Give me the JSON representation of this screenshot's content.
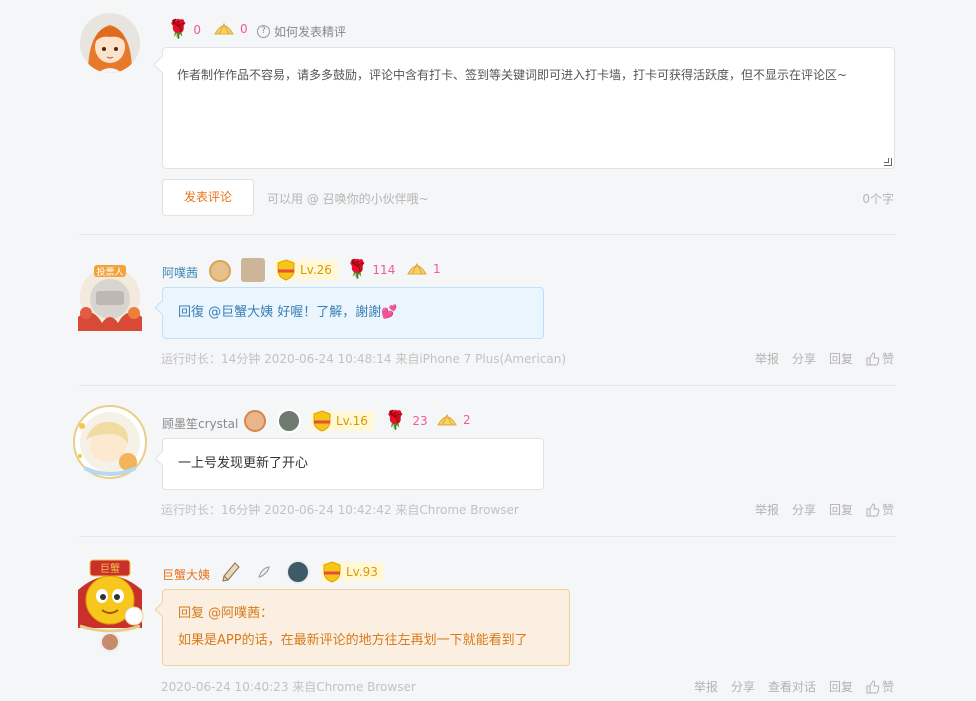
{
  "compose": {
    "flower_count": "0",
    "shell_count": "0",
    "help_label": "如何发表精评",
    "textarea_placeholder": "作者制作作品不容易，请多多鼓励，评论中含有打卡、签到等关键词即可进入打卡墙，打卡可获得活跃度，但不显示在评论区~",
    "post_button": "发表评论",
    "mention_hint": "可以用 @ 召唤你的小伙伴哦~",
    "char_count": "0个字"
  },
  "comments": [
    {
      "username": "阿噗茜",
      "username_color": "#3d8ab8",
      "level": "Lv.26",
      "flower_count": "114",
      "shell_count": "1",
      "content": "回復 @巨蟹大姨 好喔！了解，謝謝💕",
      "meta": "运行时长：14分钟   2020-06-24 10:48:14   来自iPhone 7 Plus(American)",
      "actions": [
        "举报",
        "分享",
        "回复",
        "赞"
      ]
    },
    {
      "username": "顾墨笙crystal",
      "username_color": "#888888",
      "level": "Lv.16",
      "flower_count": "23",
      "shell_count": "2",
      "content": "一上号发现更新了开心",
      "meta": "运行时长：16分钟   2020-06-24 10:42:42   来自Chrome Browser",
      "actions": [
        "举报",
        "分享",
        "回复",
        "赞"
      ]
    },
    {
      "username": "巨蟹大姨",
      "username_color": "#e8731a",
      "level": "Lv.93",
      "content_line1": "回复 @阿噗茜：",
      "content_line2": "如果是APP的话，在最新评论的地方往左再划一下就能看到了",
      "meta": "2020-06-24 10:40:23   来自Chrome Browser",
      "actions": [
        "举报",
        "分享",
        "查看对话",
        "回复",
        "赞"
      ]
    }
  ]
}
